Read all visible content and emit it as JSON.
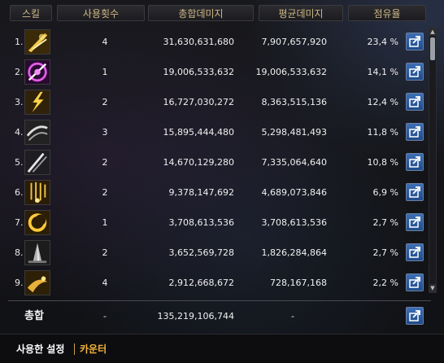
{
  "header": {
    "skill": "스킬",
    "count": "사용횟수",
    "total": "총합데미지",
    "avg": "평균데미지",
    "share": "점유율"
  },
  "rows": [
    {
      "idx": "1.",
      "count": "4",
      "total": "31,630,631,680",
      "avg": "7,907,657,920",
      "pct": "23,4 %",
      "icon": "golden-slash-skill-icon"
    },
    {
      "idx": "2.",
      "count": "1",
      "total": "19,006,533,632",
      "avg": "19,006,533,632",
      "pct": "14,1 %",
      "icon": "purple-blade-wheel-skill-icon"
    },
    {
      "idx": "3.",
      "count": "2",
      "total": "16,727,030,272",
      "avg": "8,363,515,136",
      "pct": "12,4 %",
      "icon": "lightning-strike-skill-icon"
    },
    {
      "idx": "4.",
      "count": "3",
      "total": "15,895,444,480",
      "avg": "5,298,481,493",
      "pct": "11,8 %",
      "icon": "grey-wind-slash-skill-icon"
    },
    {
      "idx": "5.",
      "count": "2",
      "total": "14,670,129,280",
      "avg": "7,335,064,640",
      "pct": "10,8 %",
      "icon": "twin-blades-skill-icon"
    },
    {
      "idx": "6.",
      "count": "2",
      "total": "9,378,147,692",
      "avg": "4,689,073,846",
      "pct": "6,9 %",
      "icon": "sword-rain-skill-icon"
    },
    {
      "idx": "7.",
      "count": "1",
      "total": "3,708,613,536",
      "avg": "3,708,613,536",
      "pct": "2,7 %",
      "icon": "golden-crescent-skill-icon"
    },
    {
      "idx": "8.",
      "count": "2",
      "total": "3,652,569,728",
      "avg": "1,826,284,864",
      "pct": "2,7 %",
      "icon": "stone-spike-skill-icon"
    },
    {
      "idx": "9.",
      "count": "4",
      "total": "2,912,668,672",
      "avg": "728,167,168",
      "pct": "2,2 %",
      "icon": "golden-sweep-skill-icon"
    }
  ],
  "total": {
    "label": "총합",
    "count": "-",
    "total": "135,219,106,744",
    "avg": "-"
  },
  "tabs": {
    "settings": "사용한 설정",
    "counter": "카운터"
  },
  "colors": {
    "header_text": "#cdb884",
    "counter_tab": "#f2b43b",
    "share_button": "#2f63a8"
  },
  "scroll": {
    "up": "▲",
    "down": "▼"
  }
}
